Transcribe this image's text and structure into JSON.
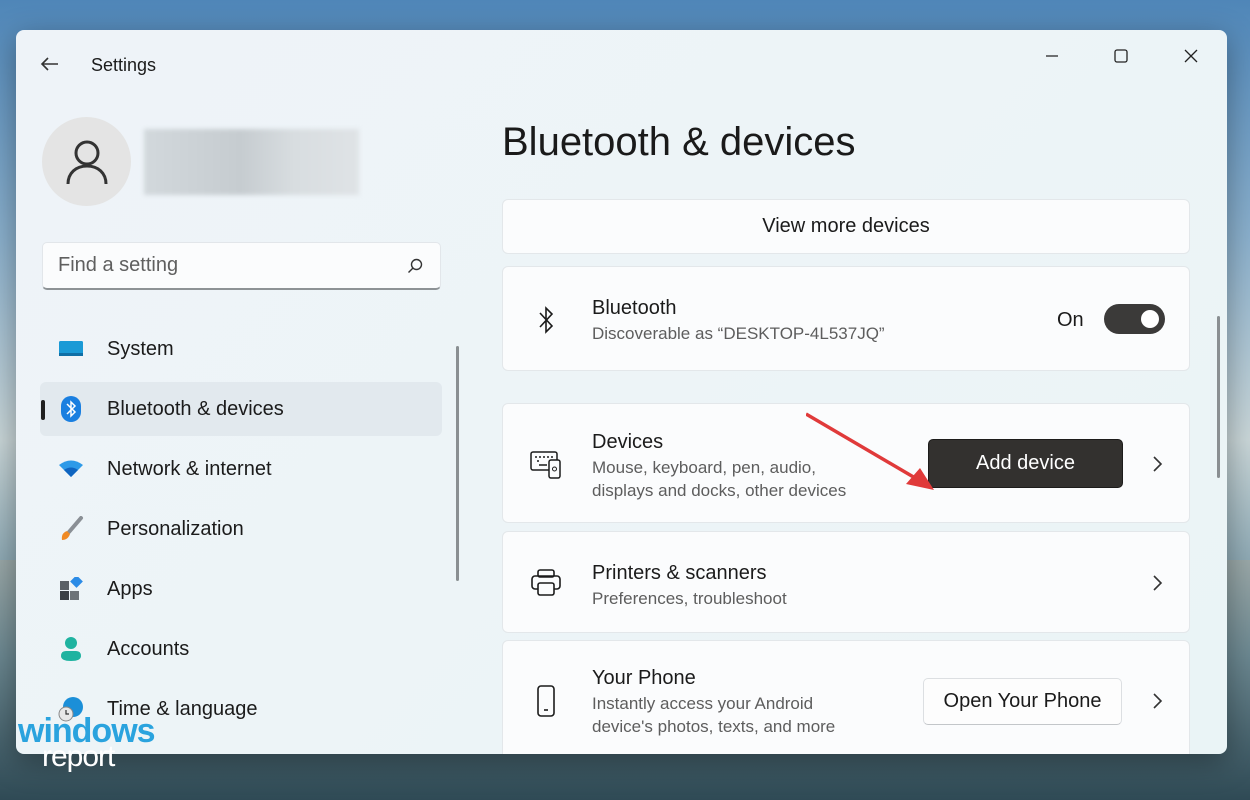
{
  "window": {
    "app_title": "Settings",
    "controls": {
      "minimize": "minimize",
      "maximize": "maximize",
      "close": "close"
    }
  },
  "user": {
    "avatar_icon": "person-icon",
    "name": ""
  },
  "search": {
    "placeholder": "Find a setting",
    "value": "",
    "icon": "search-icon"
  },
  "sidebar": {
    "items": [
      {
        "label": "System",
        "icon": "system-icon",
        "active": false
      },
      {
        "label": "Bluetooth & devices",
        "icon": "bluetooth-icon",
        "active": true
      },
      {
        "label": "Network & internet",
        "icon": "wifi-icon",
        "active": false
      },
      {
        "label": "Personalization",
        "icon": "brush-icon",
        "active": false
      },
      {
        "label": "Apps",
        "icon": "apps-icon",
        "active": false
      },
      {
        "label": "Accounts",
        "icon": "account-icon",
        "active": false
      },
      {
        "label": "Time & language",
        "icon": "globe-clock-icon",
        "active": false
      }
    ]
  },
  "main": {
    "page_title": "Bluetooth & devices",
    "view_more": "View more devices",
    "bluetooth": {
      "title": "Bluetooth",
      "subtitle": "Discoverable as “DESKTOP-4L537JQ”",
      "toggle_label": "On",
      "toggle_on": true
    },
    "devices": {
      "title": "Devices",
      "subtitle_line1": "Mouse, keyboard, pen, audio,",
      "subtitle_line2": "displays and docks, other devices",
      "button": "Add device"
    },
    "printers": {
      "title": "Printers & scanners",
      "subtitle": "Preferences, troubleshoot"
    },
    "phone": {
      "title": "Your Phone",
      "subtitle_line1": "Instantly access your Android",
      "subtitle_line2": "device's photos, texts, and more",
      "button": "Open Your Phone"
    }
  },
  "colors": {
    "accent": "#0067c0",
    "annotation_arrow": "#e03a3a",
    "primary_button": "#33312f"
  },
  "watermark": {
    "line1": "windows",
    "line2": "report"
  }
}
